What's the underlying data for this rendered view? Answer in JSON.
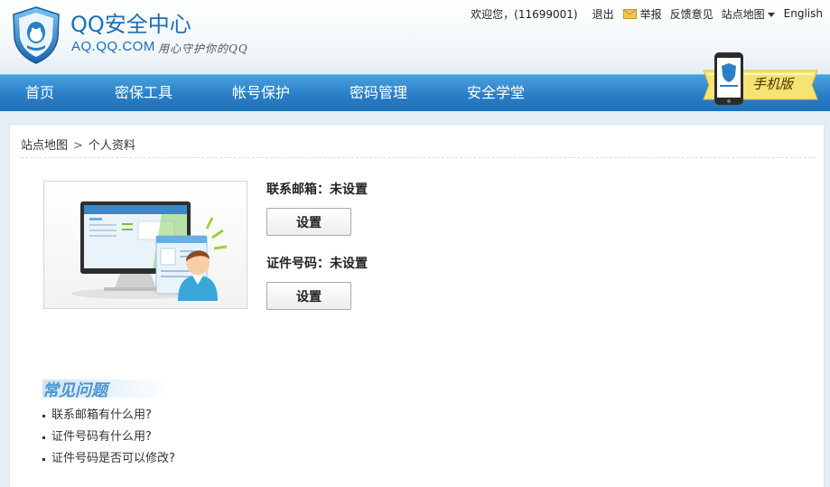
{
  "header": {
    "logo_title": "QQ安全中心",
    "logo_domain": "AQ.QQ.COM",
    "logo_slogan": "用心守护你的QQ"
  },
  "topbar": {
    "welcome": "欢迎您，(11699001)",
    "logout": "退出",
    "report": "举报",
    "feedback": "反馈意见",
    "sitemap": "站点地图",
    "english": "English"
  },
  "nav": {
    "items": [
      "首页",
      "密保工具",
      "帐号保护",
      "密码管理",
      "安全学堂"
    ],
    "mobile_label": "手机版"
  },
  "breadcrumb": {
    "root": "站点地图",
    "separator": ">",
    "current": "个人资料"
  },
  "profile": {
    "email_label": "联系邮箱：未设置",
    "email_button": "设置",
    "id_label": "证件号码：未设置",
    "id_button": "设置"
  },
  "faq": {
    "title": "常见问题",
    "items": [
      "联系邮箱有什么用?",
      "证件号码有什么用?",
      "证件号码是否可以修改?"
    ]
  },
  "colors": {
    "nav_blue": "#2a7fc6",
    "brand_blue": "#1a6fb8",
    "faq_title": "#4b96cf"
  }
}
